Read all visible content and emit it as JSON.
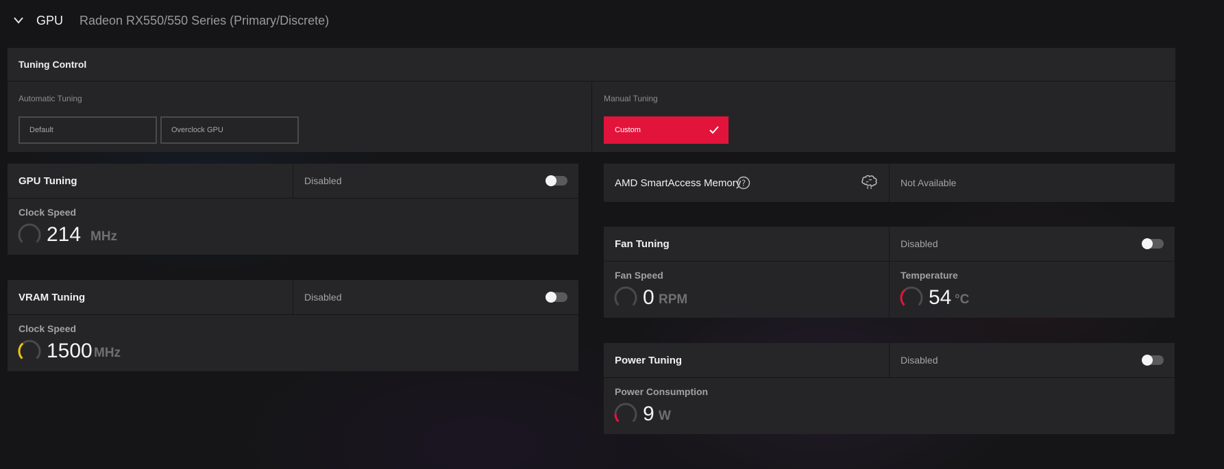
{
  "header": {
    "section": "GPU",
    "device": "Radeon RX550/550 Series (Primary/Discrete)"
  },
  "tuning_control": {
    "title": "Tuning Control",
    "automatic": {
      "label": "Automatic Tuning",
      "default_btn": "Default",
      "overclock_btn": "Overclock GPU"
    },
    "manual": {
      "label": "Manual Tuning",
      "custom_btn": "Custom"
    }
  },
  "gpu_tuning": {
    "title": "GPU Tuning",
    "status": "Disabled",
    "metric_label": "Clock Speed",
    "value": "214",
    "unit": "MHz",
    "gauge_fraction": 0.0,
    "gauge_color": "#4a4a4a"
  },
  "vram_tuning": {
    "title": "VRAM Tuning",
    "status": "Disabled",
    "metric_label": "Clock Speed",
    "value": "1500",
    "unit": "MHz",
    "gauge_fraction": 0.35,
    "gauge_color": "#f1c40f"
  },
  "smart_access": {
    "title": "AMD SmartAccess Memory",
    "status": "Not Available"
  },
  "fan_tuning": {
    "title": "Fan Tuning",
    "status": "Disabled",
    "fan": {
      "label": "Fan Speed",
      "value": "0",
      "unit": "RPM",
      "gauge_fraction": 0.0,
      "gauge_color": "#4a4a4a"
    },
    "temp": {
      "label": "Temperature",
      "value": "54",
      "unit": "°C",
      "gauge_fraction": 0.35,
      "gauge_color": "#e2143c"
    }
  },
  "power_tuning": {
    "title": "Power Tuning",
    "status": "Disabled",
    "metric_label": "Power Consumption",
    "value": "9",
    "unit": "W",
    "gauge_fraction": 0.18,
    "gauge_color": "#e2143c"
  },
  "colors": {
    "accent": "#e2143c",
    "panel": "#252527",
    "background": "#151517"
  }
}
